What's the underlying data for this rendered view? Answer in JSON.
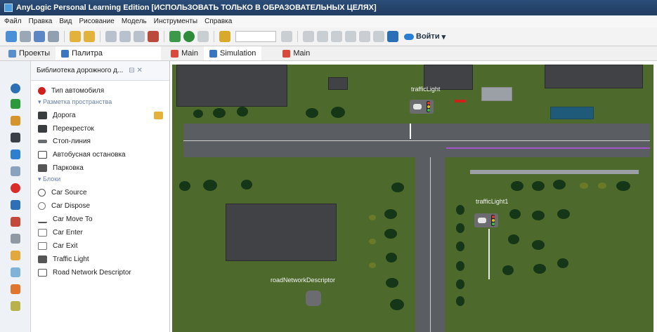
{
  "window": {
    "title": "AnyLogic Personal Learning Edition [ИСПОЛЬЗОВАТЬ ТОЛЬКО В ОБРАЗОВАТЕЛЬНЫХ ЦЕЛЯХ]"
  },
  "menu": [
    "Файл",
    "Правка",
    "Вид",
    "Рисование",
    "Модель",
    "Инструменты",
    "Справка"
  ],
  "toolbar": {
    "login_label": "Войти"
  },
  "panel_tabs": {
    "projects": "Проекты",
    "palette": "Палитра"
  },
  "editor_tabs": [
    "Main",
    "Simulation",
    "Main"
  ],
  "palette": {
    "title": "Библиотека дорожного д...",
    "vehicle_type": "Тип автомобиля",
    "section_space": "Разметка пространства",
    "space_items": [
      "Дорога",
      "Перекресток",
      "Стоп-линия",
      "Автобусная остановка",
      "Парковка"
    ],
    "section_blocks": "Блоки",
    "block_items": [
      "Car Source",
      "Car Dispose",
      "Car Move To",
      "Car Enter",
      "Car Exit",
      "Traffic Light",
      "Road Network Descriptor"
    ]
  },
  "canvas": {
    "label_light1": "trafficLight",
    "label_light2": "trafficLight1",
    "label_descriptor": "roadNetworkDescriptor"
  },
  "colors": {
    "titlebar": "#203c61",
    "canvas_green": "#4d6a2c",
    "road": "#5a5d61",
    "accent_red": "#d0201c"
  }
}
